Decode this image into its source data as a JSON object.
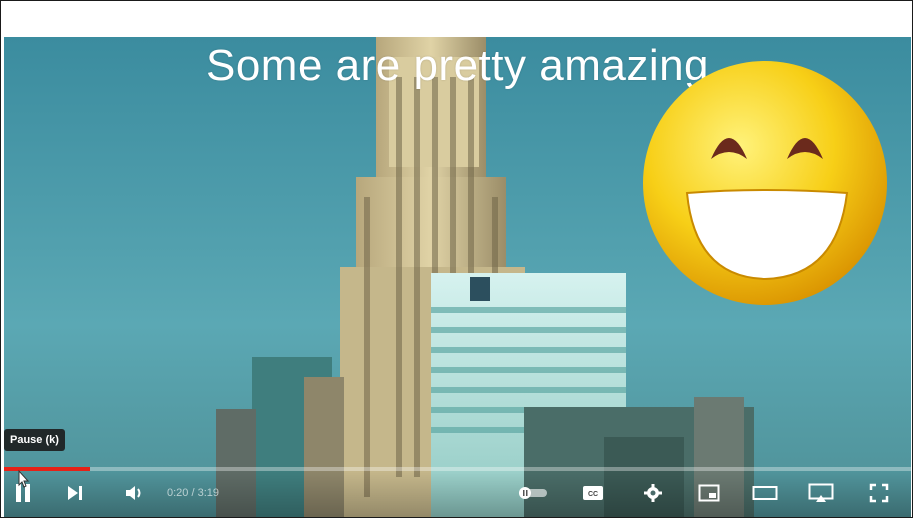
{
  "caption": "Some are pretty amazing",
  "tooltip": "Pause (k)",
  "player": {
    "time_display": "0:20 / 3:19",
    "progress_fraction": 0.095,
    "accent_color": "#e62117"
  },
  "icons": {
    "pause": "pause-icon",
    "next": "next-icon",
    "volume": "volume-icon",
    "autoplay": "autoplay-toggle-icon",
    "captions": "captions-icon",
    "settings": "gear-icon",
    "miniplayer": "miniplayer-icon",
    "theater": "theater-mode-icon",
    "cast": "cast-icon",
    "fullscreen": "fullscreen-icon",
    "emoji": "grinning-face-emoji"
  }
}
